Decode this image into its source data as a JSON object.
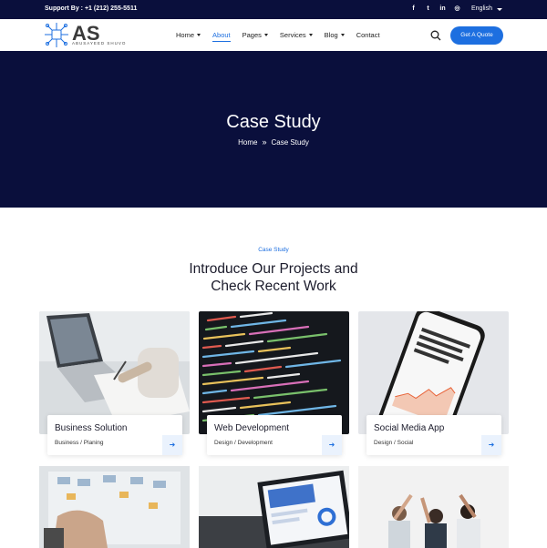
{
  "topbar": {
    "support": "Support By : +1 (212) 255-5511",
    "socials": [
      {
        "icon": "facebook-icon",
        "glyph": "f"
      },
      {
        "icon": "twitter-icon",
        "glyph": "t"
      },
      {
        "icon": "linkedin-icon",
        "glyph": "in"
      },
      {
        "icon": "instagram-icon",
        "glyph": "◎"
      }
    ],
    "language": "English"
  },
  "logo": {
    "text": "AS",
    "subtext": "ABUSAYEED SHUVO"
  },
  "nav": {
    "items": [
      {
        "label": "Home",
        "dropdown": true
      },
      {
        "label": "About",
        "dropdown": false,
        "active": true
      },
      {
        "label": "Pages",
        "dropdown": true
      },
      {
        "label": "Services",
        "dropdown": true
      },
      {
        "label": "Blog",
        "dropdown": true
      },
      {
        "label": "Contact",
        "dropdown": false
      }
    ],
    "cta": "Get A Quote"
  },
  "hero": {
    "title": "Case Study",
    "breadcrumb": {
      "home": "Home",
      "separator": "»",
      "current": "Case Study"
    }
  },
  "section": {
    "eyebrow": "Case Study",
    "title_line1": "Introduce Our Projects and",
    "title_line2": "Check Recent Work"
  },
  "cards": [
    {
      "title": "Business Solution",
      "category": "Business / Planing"
    },
    {
      "title": "Web Development",
      "category": "Design / Development"
    },
    {
      "title": "Social Media App",
      "category": "Design / Social"
    }
  ],
  "colors": {
    "navy": "#0a0f3c",
    "accent": "#1d6fe0"
  }
}
